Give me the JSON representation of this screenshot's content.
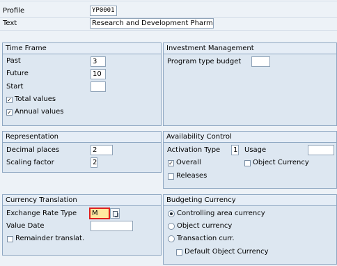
{
  "header": {
    "profile_label": "Profile",
    "profile_value": "YP0001",
    "text_label": "Text",
    "text_value": "Research and Development Pharm"
  },
  "time_frame": {
    "title": "Time Frame",
    "past_label": "Past",
    "past_value": "3",
    "future_label": "Future",
    "future_value": "10",
    "start_label": "Start",
    "start_value": "",
    "total_values_label": "Total values",
    "total_values_checked": true,
    "annual_values_label": "Annual values",
    "annual_values_checked": true
  },
  "investment_management": {
    "title": "Investment Management",
    "program_type_label": "Program type budget",
    "program_type_value": ""
  },
  "representation": {
    "title": "Representation",
    "decimal_label": "Decimal places",
    "decimal_value": "2",
    "scaling_label": "Scaling factor",
    "scaling_value": "2"
  },
  "availability_control": {
    "title": "Availability Control",
    "activation_label": "Activation Type",
    "activation_value": "1",
    "usage_label": "Usage",
    "usage_value": "",
    "overall_label": "Overall",
    "overall_checked": true,
    "object_currency_label": "Object Currency",
    "object_currency_checked": false,
    "releases_label": "Releases",
    "releases_checked": false
  },
  "currency_translation": {
    "title": "Currency Translation",
    "exchange_rate_label": "Exchange Rate Type",
    "exchange_rate_value": "M",
    "value_date_label": "Value Date",
    "value_date_value": "",
    "remainder_label": "Remainder translat.",
    "remainder_checked": false
  },
  "budgeting_currency": {
    "title": "Budgeting Currency",
    "controlling_label": "Controlling area currency",
    "object_label": "Object currency",
    "transaction_label": "Transaction curr.",
    "selected": "Controlling area currency",
    "default_object_label": "Default Object Currency",
    "default_object_checked": false
  },
  "icons": {
    "checkbox_checked": "check-icon",
    "radio_selected": "radio-dot-icon",
    "f4_help": "value-help-icon"
  },
  "colors": {
    "background": "#edf2f7",
    "group_background": "#dde7f1",
    "group_border": "#8ea7c2",
    "focus_field": "#ffe8a0",
    "focus_border": "#e0201e"
  }
}
